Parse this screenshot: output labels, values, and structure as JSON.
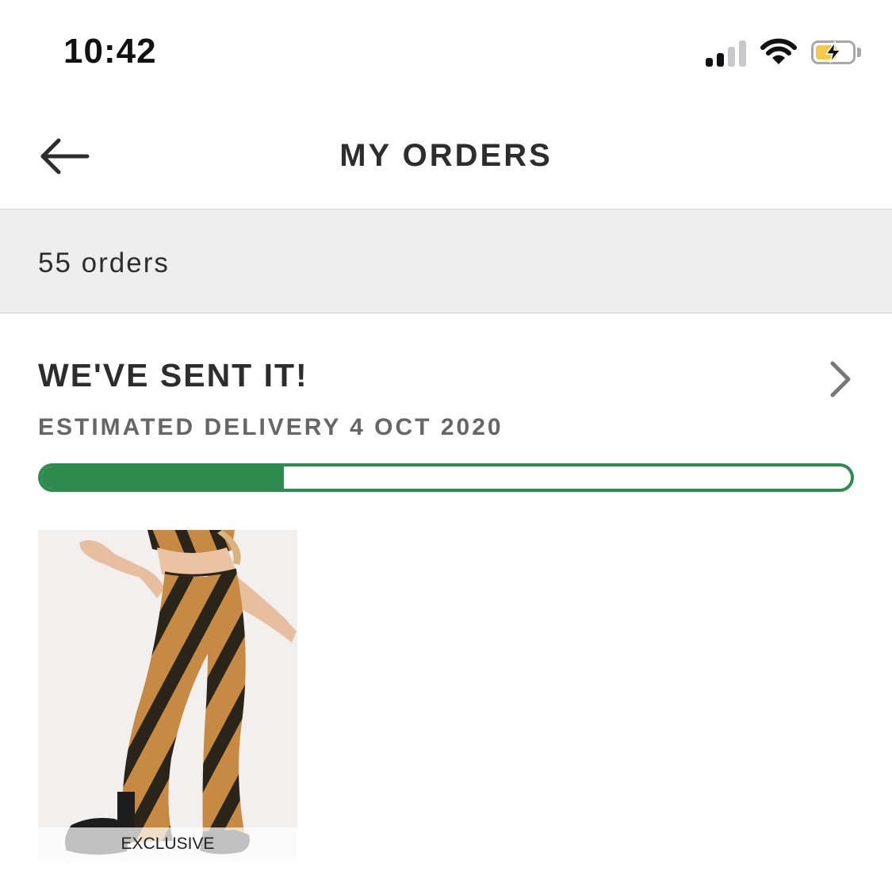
{
  "status_bar": {
    "time": "10:42",
    "signal_icon": "cellular-signal-icon",
    "wifi_icon": "wifi-icon",
    "battery_icon": "battery-charging-icon",
    "battery_color": "#f7c948"
  },
  "header": {
    "back_icon": "arrow-left-icon",
    "title": "MY ORDERS"
  },
  "orders_summary": {
    "count_label": "55 orders"
  },
  "order": {
    "status": "WE'VE SENT IT!",
    "delivery": "ESTIMATED DELIVERY 4 OCT 2020",
    "progress": 0.3,
    "progress_color": "#2e8b4e",
    "chevron_icon": "chevron-right-icon",
    "product": {
      "image": "zebra-print-flared-trousers",
      "badge": "EXCLUSIVE"
    }
  }
}
